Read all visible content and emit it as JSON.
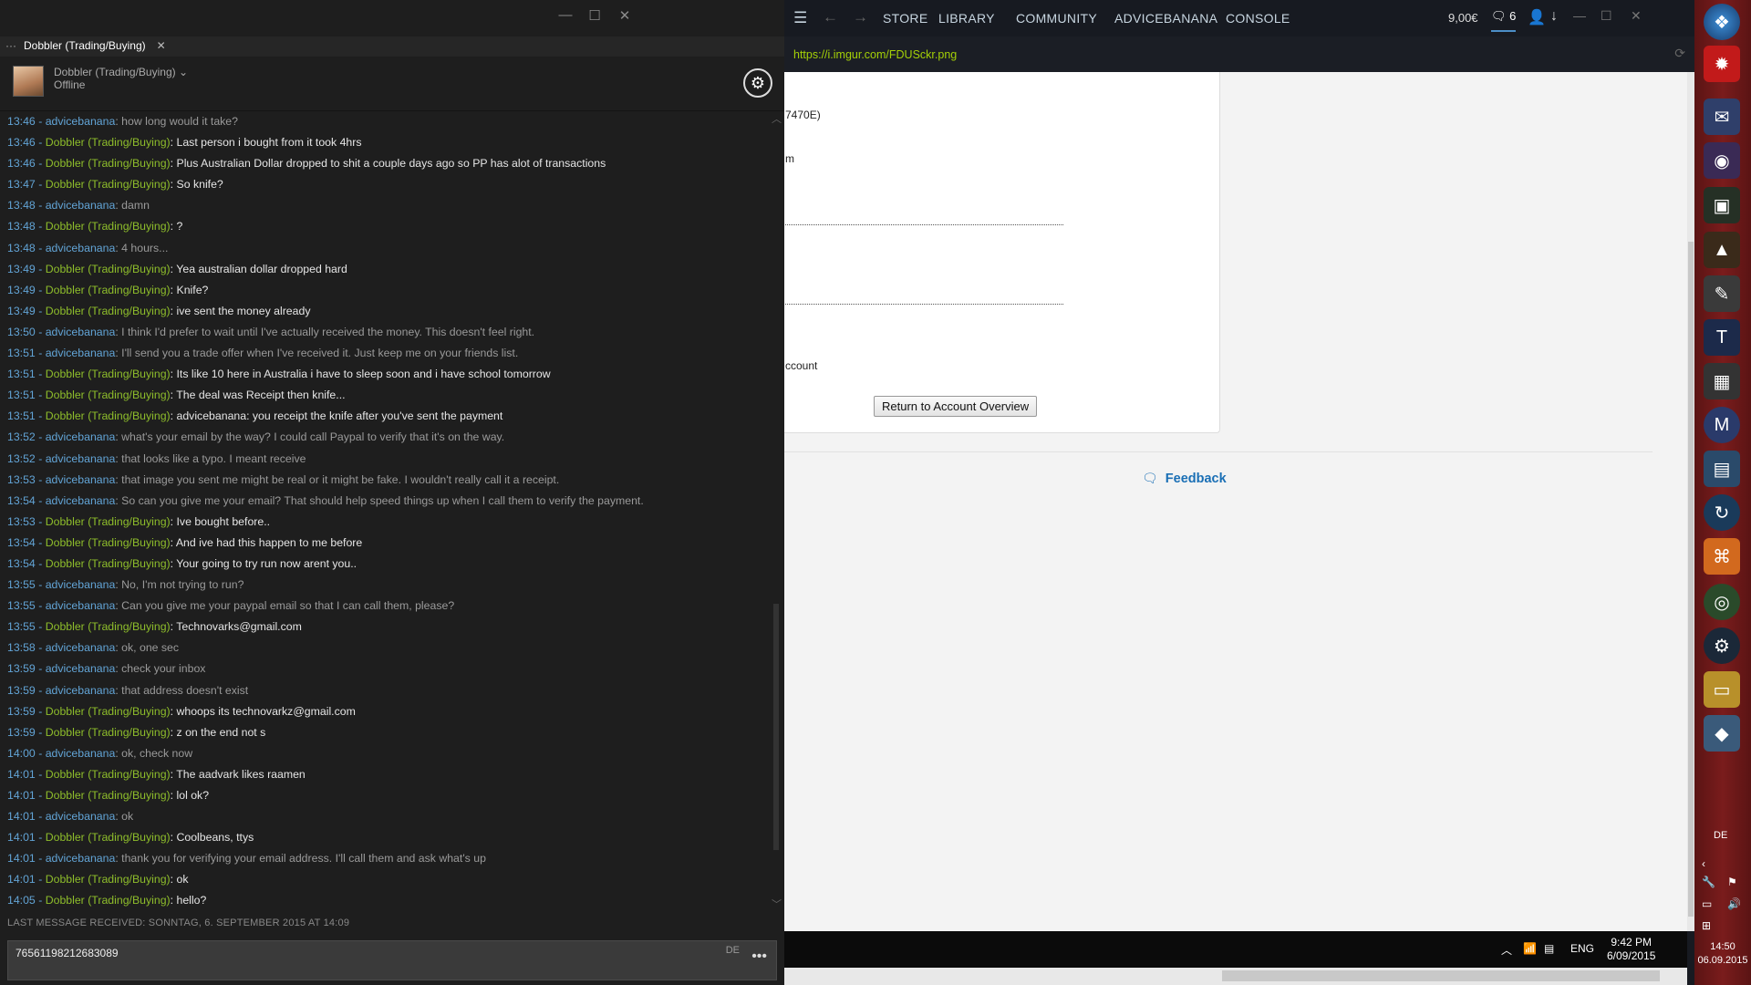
{
  "chat": {
    "tab_label": "Dobbler (Trading/Buying)",
    "friend_name": "Dobbler (Trading/Buying)",
    "friend_status": "Offline",
    "messages": [
      {
        "time": "13:46",
        "who": "advicebanana",
        "text": "how long would it take?"
      },
      {
        "time": "13:46",
        "who": "Dobbler (Trading/Buying)",
        "text": "Last person i bought from it took 4hrs"
      },
      {
        "time": "13:46",
        "who": "Dobbler (Trading/Buying)",
        "text": "Plus Australian Dollar dropped to shit a couple days ago so PP has alot of transactions"
      },
      {
        "time": "13:47",
        "who": "Dobbler (Trading/Buying)",
        "text": "So knife?"
      },
      {
        "time": "13:48",
        "who": "advicebanana",
        "text": "damn"
      },
      {
        "time": "13:48",
        "who": "Dobbler (Trading/Buying)",
        "text": "?"
      },
      {
        "time": "13:48",
        "who": "advicebanana",
        "text": "4 hours..."
      },
      {
        "time": "13:49",
        "who": "Dobbler (Trading/Buying)",
        "text": "Yea australian dollar dropped hard"
      },
      {
        "time": "13:49",
        "who": "Dobbler (Trading/Buying)",
        "text": "Knife?"
      },
      {
        "time": "13:49",
        "who": "Dobbler (Trading/Buying)",
        "text": "ive sent the money already"
      },
      {
        "time": "13:50",
        "who": "advicebanana",
        "text": "I think I'd prefer to wait until I've actually received the money. This doesn't feel right."
      },
      {
        "time": "13:51",
        "who": "advicebanana",
        "text": "I'll send you a trade offer when I've received it. Just keep me on your friends list."
      },
      {
        "time": "13:51",
        "who": "Dobbler (Trading/Buying)",
        "text": "Its like 10 here in Australia i have to sleep soon and i have school tomorrow"
      },
      {
        "time": "13:51",
        "who": "Dobbler (Trading/Buying)",
        "text": "The deal was Receipt then knife..."
      },
      {
        "time": "13:51",
        "who": "Dobbler (Trading/Buying)",
        "text": "advicebanana: you receipt the knife after you've sent the payment"
      },
      {
        "time": "13:52",
        "who": "advicebanana",
        "text": "what's your email by the way? I could call Paypal to verify that it's on the way."
      },
      {
        "time": "13:52",
        "who": "advicebanana",
        "text": "that looks like a typo. I meant receive"
      },
      {
        "time": "13:53",
        "who": "advicebanana",
        "text": "that image you sent me might be real or it might be fake. I wouldn't really call it a receipt."
      },
      {
        "time": "13:54",
        "who": "advicebanana",
        "text": "So can you give me your email? That should help speed things up when I call them to verify the payment."
      },
      {
        "time": "13:53",
        "who": "Dobbler (Trading/Buying)",
        "text": "Ive bought before.."
      },
      {
        "time": "13:54",
        "who": "Dobbler (Trading/Buying)",
        "text": "And ive had this happen to me before"
      },
      {
        "time": "13:54",
        "who": "Dobbler (Trading/Buying)",
        "text": "Your going to try run now arent you.."
      },
      {
        "time": "13:55",
        "who": "advicebanana",
        "text": "No, I'm not trying to run?"
      },
      {
        "time": "13:55",
        "who": "advicebanana",
        "text": "Can you give me your paypal email so that I can call them, please?"
      },
      {
        "time": "13:55",
        "who": "Dobbler (Trading/Buying)",
        "text": "Technovarks@gmail.com"
      },
      {
        "time": "13:58",
        "who": "advicebanana",
        "text": "ok, one sec"
      },
      {
        "time": "13:59",
        "who": "advicebanana",
        "text": "check your inbox"
      },
      {
        "time": "13:59",
        "who": "advicebanana",
        "text": "that address doesn't exist"
      },
      {
        "time": "13:59",
        "who": "Dobbler (Trading/Buying)",
        "text": "whoops its technovarkz@gmail.com"
      },
      {
        "time": "13:59",
        "who": "Dobbler (Trading/Buying)",
        "text": "z on the end not s"
      },
      {
        "time": "14:00",
        "who": "advicebanana",
        "text": "ok, check now"
      },
      {
        "time": "14:01",
        "who": "Dobbler (Trading/Buying)",
        "text": "The aadvark likes raamen"
      },
      {
        "time": "14:01",
        "who": "Dobbler (Trading/Buying)",
        "text": "lol ok?"
      },
      {
        "time": "14:01",
        "who": "advicebanana",
        "text": "ok"
      },
      {
        "time": "14:01",
        "who": "Dobbler (Trading/Buying)",
        "text": "Coolbeans, ttys"
      },
      {
        "time": "14:01",
        "who": "advicebanana",
        "text": "thank you for verifying your email address. I'll call them and ask what's up"
      },
      {
        "time": "14:01",
        "who": "Dobbler (Trading/Buying)",
        "text": "ok"
      },
      {
        "time": "14:05",
        "who": "Dobbler (Trading/Buying)",
        "text": "hello?"
      }
    ],
    "last_received": "LAST MESSAGE RECEIVED: SONNTAG, 6. SEPTEMBER 2015 AT 14:09",
    "input_value": "76561198212683089",
    "input_lang": "DE"
  },
  "steam": {
    "nav": [
      "STORE",
      "LIBRARY",
      "COMMUNITY",
      "ADVICEBANANA",
      "CONSOLE"
    ],
    "wallet": "9,00€",
    "notifications": "6",
    "url": "https://i.imgur.com/FDUSckr.png",
    "page": {
      "fragment1": "7470E)",
      "fragment2": "m",
      "fragment3": "ccount",
      "return_button": "Return to Account Overview",
      "feedback": "Feedback"
    },
    "taskbar": {
      "lang": "ENG",
      "time": "9:42 PM",
      "date": "6/09/2015"
    }
  },
  "dock": {
    "lang": "DE",
    "time": "14:50",
    "date": "06.09.2015"
  },
  "colors": {
    "self_name": "#62a4d6",
    "friend_name": "#8ebd2b",
    "url": "#a4d007",
    "link": "#1a6fb5"
  }
}
